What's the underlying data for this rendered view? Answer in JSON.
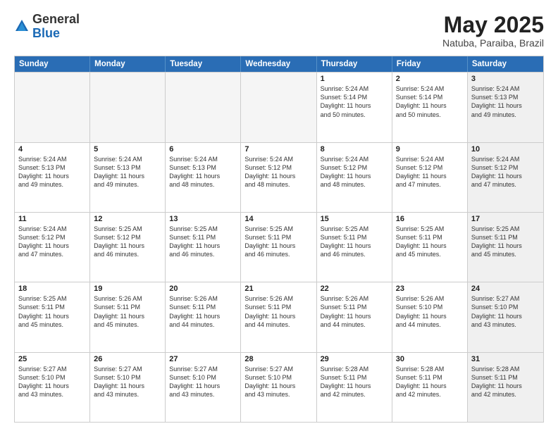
{
  "header": {
    "logo_general": "General",
    "logo_blue": "Blue",
    "title": "May 2025",
    "location": "Natuba, Paraiba, Brazil"
  },
  "weekdays": [
    "Sunday",
    "Monday",
    "Tuesday",
    "Wednesday",
    "Thursday",
    "Friday",
    "Saturday"
  ],
  "weeks": [
    [
      {
        "day": "",
        "detail": "",
        "empty": true
      },
      {
        "day": "",
        "detail": "",
        "empty": true
      },
      {
        "day": "",
        "detail": "",
        "empty": true
      },
      {
        "day": "",
        "detail": "",
        "empty": true
      },
      {
        "day": "1",
        "detail": "Sunrise: 5:24 AM\nSunset: 5:14 PM\nDaylight: 11 hours\nand 50 minutes."
      },
      {
        "day": "2",
        "detail": "Sunrise: 5:24 AM\nSunset: 5:14 PM\nDaylight: 11 hours\nand 50 minutes."
      },
      {
        "day": "3",
        "detail": "Sunrise: 5:24 AM\nSunset: 5:13 PM\nDaylight: 11 hours\nand 49 minutes.",
        "shaded": true
      }
    ],
    [
      {
        "day": "4",
        "detail": "Sunrise: 5:24 AM\nSunset: 5:13 PM\nDaylight: 11 hours\nand 49 minutes."
      },
      {
        "day": "5",
        "detail": "Sunrise: 5:24 AM\nSunset: 5:13 PM\nDaylight: 11 hours\nand 49 minutes."
      },
      {
        "day": "6",
        "detail": "Sunrise: 5:24 AM\nSunset: 5:13 PM\nDaylight: 11 hours\nand 48 minutes."
      },
      {
        "day": "7",
        "detail": "Sunrise: 5:24 AM\nSunset: 5:12 PM\nDaylight: 11 hours\nand 48 minutes."
      },
      {
        "day": "8",
        "detail": "Sunrise: 5:24 AM\nSunset: 5:12 PM\nDaylight: 11 hours\nand 48 minutes."
      },
      {
        "day": "9",
        "detail": "Sunrise: 5:24 AM\nSunset: 5:12 PM\nDaylight: 11 hours\nand 47 minutes."
      },
      {
        "day": "10",
        "detail": "Sunrise: 5:24 AM\nSunset: 5:12 PM\nDaylight: 11 hours\nand 47 minutes.",
        "shaded": true
      }
    ],
    [
      {
        "day": "11",
        "detail": "Sunrise: 5:24 AM\nSunset: 5:12 PM\nDaylight: 11 hours\nand 47 minutes."
      },
      {
        "day": "12",
        "detail": "Sunrise: 5:25 AM\nSunset: 5:12 PM\nDaylight: 11 hours\nand 46 minutes."
      },
      {
        "day": "13",
        "detail": "Sunrise: 5:25 AM\nSunset: 5:11 PM\nDaylight: 11 hours\nand 46 minutes."
      },
      {
        "day": "14",
        "detail": "Sunrise: 5:25 AM\nSunset: 5:11 PM\nDaylight: 11 hours\nand 46 minutes."
      },
      {
        "day": "15",
        "detail": "Sunrise: 5:25 AM\nSunset: 5:11 PM\nDaylight: 11 hours\nand 46 minutes."
      },
      {
        "day": "16",
        "detail": "Sunrise: 5:25 AM\nSunset: 5:11 PM\nDaylight: 11 hours\nand 45 minutes."
      },
      {
        "day": "17",
        "detail": "Sunrise: 5:25 AM\nSunset: 5:11 PM\nDaylight: 11 hours\nand 45 minutes.",
        "shaded": true
      }
    ],
    [
      {
        "day": "18",
        "detail": "Sunrise: 5:25 AM\nSunset: 5:11 PM\nDaylight: 11 hours\nand 45 minutes."
      },
      {
        "day": "19",
        "detail": "Sunrise: 5:26 AM\nSunset: 5:11 PM\nDaylight: 11 hours\nand 45 minutes."
      },
      {
        "day": "20",
        "detail": "Sunrise: 5:26 AM\nSunset: 5:11 PM\nDaylight: 11 hours\nand 44 minutes."
      },
      {
        "day": "21",
        "detail": "Sunrise: 5:26 AM\nSunset: 5:11 PM\nDaylight: 11 hours\nand 44 minutes."
      },
      {
        "day": "22",
        "detail": "Sunrise: 5:26 AM\nSunset: 5:11 PM\nDaylight: 11 hours\nand 44 minutes."
      },
      {
        "day": "23",
        "detail": "Sunrise: 5:26 AM\nSunset: 5:10 PM\nDaylight: 11 hours\nand 44 minutes."
      },
      {
        "day": "24",
        "detail": "Sunrise: 5:27 AM\nSunset: 5:10 PM\nDaylight: 11 hours\nand 43 minutes.",
        "shaded": true
      }
    ],
    [
      {
        "day": "25",
        "detail": "Sunrise: 5:27 AM\nSunset: 5:10 PM\nDaylight: 11 hours\nand 43 minutes."
      },
      {
        "day": "26",
        "detail": "Sunrise: 5:27 AM\nSunset: 5:10 PM\nDaylight: 11 hours\nand 43 minutes."
      },
      {
        "day": "27",
        "detail": "Sunrise: 5:27 AM\nSunset: 5:10 PM\nDaylight: 11 hours\nand 43 minutes."
      },
      {
        "day": "28",
        "detail": "Sunrise: 5:27 AM\nSunset: 5:10 PM\nDaylight: 11 hours\nand 43 minutes."
      },
      {
        "day": "29",
        "detail": "Sunrise: 5:28 AM\nSunset: 5:11 PM\nDaylight: 11 hours\nand 42 minutes."
      },
      {
        "day": "30",
        "detail": "Sunrise: 5:28 AM\nSunset: 5:11 PM\nDaylight: 11 hours\nand 42 minutes."
      },
      {
        "day": "31",
        "detail": "Sunrise: 5:28 AM\nSunset: 5:11 PM\nDaylight: 11 hours\nand 42 minutes.",
        "shaded": true
      }
    ]
  ]
}
